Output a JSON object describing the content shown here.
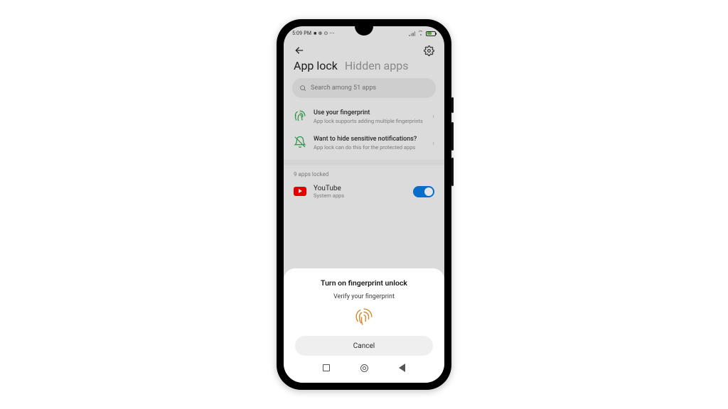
{
  "status": {
    "time": "5:09 PM",
    "icons_label": "■ ⊕ ⊙ ⋯"
  },
  "tabs": {
    "active": "App lock",
    "inactive": "Hidden apps"
  },
  "search": {
    "placeholder": "Search among 51 apps"
  },
  "info1": {
    "title": "Use your fingerprint",
    "subtitle": "App lock supports adding multiple fingerprints"
  },
  "info2": {
    "title": "Want to hide sensitive notifications?",
    "subtitle": "App lock can do this for the protected apps"
  },
  "section": {
    "locked_label": "9 apps locked"
  },
  "app1": {
    "name": "YouTube",
    "category": "System apps"
  },
  "sheet": {
    "title": "Turn on fingerprint unlock",
    "message": "Verify your fingerprint",
    "cancel": "Cancel"
  }
}
